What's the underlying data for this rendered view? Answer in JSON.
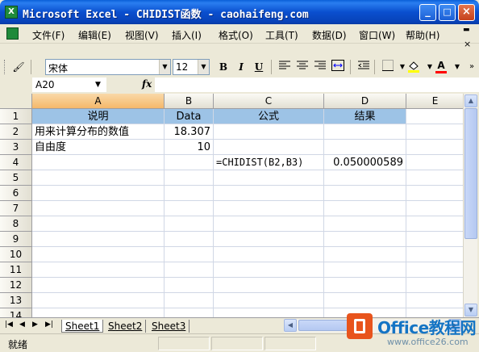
{
  "window": {
    "title": "Microsoft Excel - CHIDIST函数 - caohaifeng.com",
    "app_icon": "excel-icon",
    "controls": [
      "_",
      "□",
      "×"
    ]
  },
  "menu": {
    "items": [
      "文件(F)",
      "编辑(E)",
      "视图(V)",
      "插入(I)",
      "格式(O)",
      "工具(T)",
      "数据(D)",
      "窗口(W)",
      "帮助(H)"
    ],
    "doc_minimize": "▬",
    "doc_restore": "❐",
    "doc_close": "×"
  },
  "toolbar": {
    "font_name": "宋体",
    "font_size": "12",
    "bold": "B",
    "italic": "I",
    "underline": "U",
    "fill_color": "#ffff00",
    "font_color": "#ff0000",
    "font_color_letter": "A"
  },
  "formula_bar": {
    "name_box": "A20",
    "fx": "fx",
    "formula": ""
  },
  "grid": {
    "columns": [
      "A",
      "B",
      "C",
      "D",
      "E"
    ],
    "rows": [
      "1",
      "2",
      "3",
      "4",
      "5",
      "6",
      "7",
      "8",
      "9",
      "10",
      "11",
      "12",
      "13",
      "14"
    ],
    "cells": {
      "A1": "说明",
      "B1": "Data",
      "C1": "公式",
      "D1": "结果",
      "A2": "用来计算分布的数值",
      "B2": "18.307",
      "A3": "自由度",
      "B3": "10",
      "C4": "=CHIDIST(B2,B3)",
      "D4": "0.050000589"
    },
    "header_fill": "#9dc3e6",
    "selected_column": "A"
  },
  "sheets": {
    "tabs": [
      "Sheet1",
      "Sheet2",
      "Sheet3"
    ],
    "active": "Sheet1"
  },
  "status": {
    "text": "就绪"
  },
  "watermark": {
    "brand": "Office教程网",
    "url": "www.office26.com"
  }
}
